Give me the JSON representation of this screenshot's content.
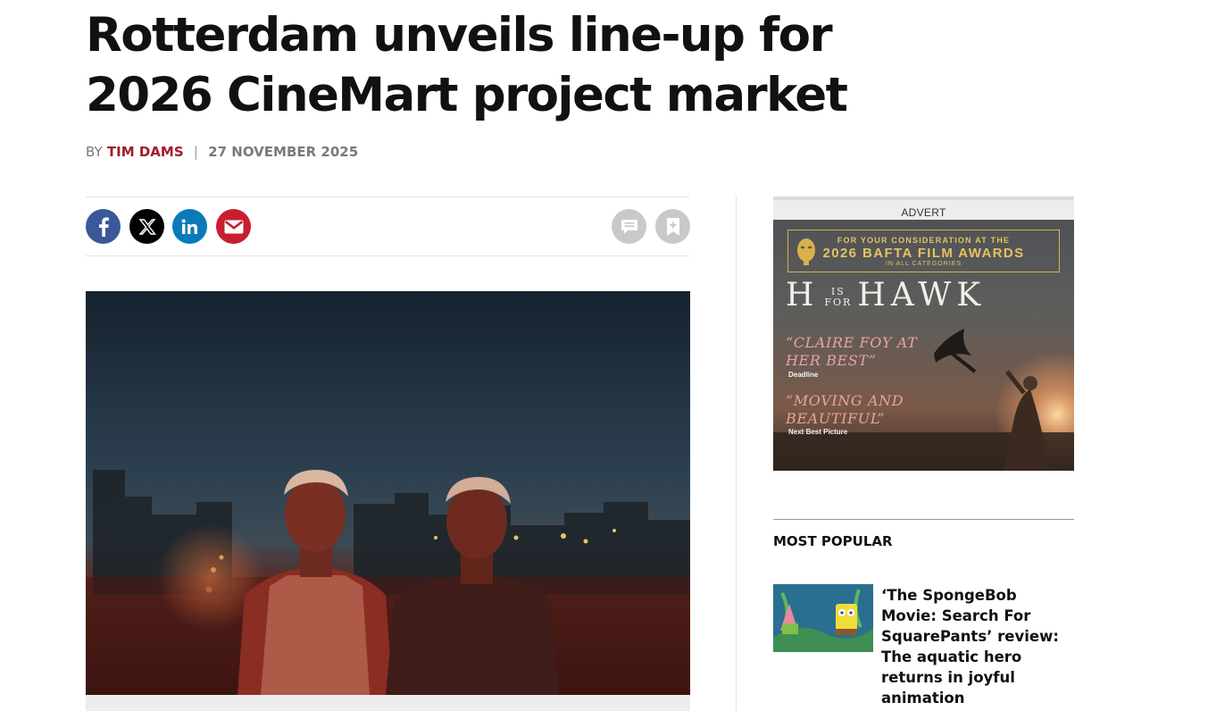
{
  "article": {
    "headline": "Rotterdam unveils line-up for 2026 CineMart project market",
    "byline_prefix": "BY",
    "author": "TIM DAMS",
    "separator": "|",
    "date": "27 NOVEMBER 2025"
  },
  "share": {
    "icons": [
      "facebook-icon",
      "x-icon",
      "linkedin-icon",
      "email-icon",
      "comment-icon",
      "bookmark-icon"
    ],
    "colors": {
      "facebook": "#3b5998",
      "x": "#000000",
      "linkedin": "#0a7bb8",
      "email": "#c81f2e",
      "tools": "#c9c9c9"
    }
  },
  "sidebar": {
    "advert_label": "ADVERT",
    "ad": {
      "fyc_line1": "FOR YOUR CONSIDERATION AT THE",
      "fyc_line2": "2026 BAFTA FILM AWARDS",
      "fyc_line3": "IN ALL CATEGORIES",
      "title_h": "H",
      "title_is": "IS",
      "title_for": "FOR",
      "title_hawk": "HAWK",
      "quote1": "“CLAIRE FOY AT HER BEST”",
      "source1": "Deadline",
      "quote2": "“MOVING AND BEAUTIFUL”",
      "source2": "Next Best Picture"
    },
    "most_popular": {
      "title": "MOST POPULAR",
      "items": [
        {
          "headline": "‘The SpongeBob Movie: Search For SquarePants’ review: The aquatic hero returns in joyful animation"
        }
      ]
    }
  },
  "theme": {
    "author_color": "#a31c29",
    "ad_gold": "#d9b24a"
  }
}
